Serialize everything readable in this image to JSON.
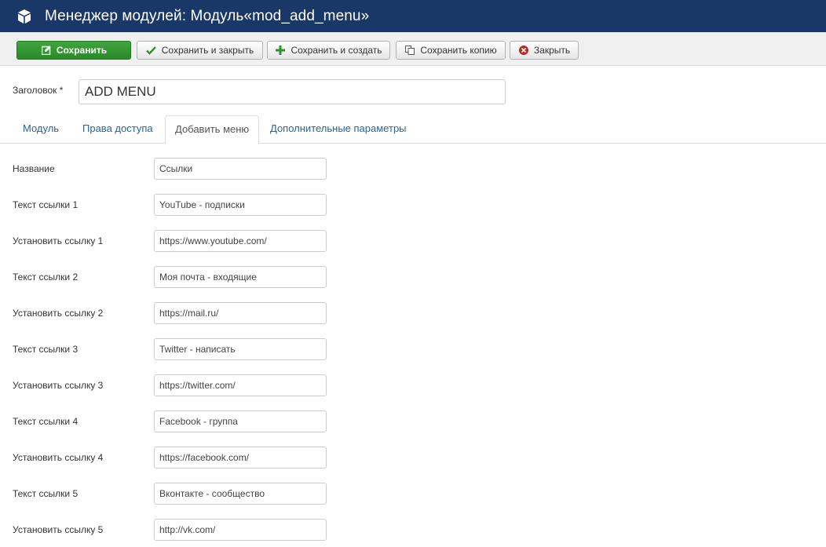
{
  "header": {
    "title": "Менеджер модулей: Модуль«mod_add_menu»",
    "icon": "cube-icon"
  },
  "toolbar": {
    "save": "Сохранить",
    "save_close": "Сохранить и закрыть",
    "save_new": "Сохранить и создать",
    "save_copy": "Сохранить копию",
    "close": "Закрыть"
  },
  "title_field": {
    "label": "Заголовок *",
    "value": "ADD MENU"
  },
  "tabs": [
    {
      "label": "Модуль"
    },
    {
      "label": "Права доступа"
    },
    {
      "label": "Добавить меню",
      "active": true
    },
    {
      "label": "Дополнительные параметры"
    }
  ],
  "fields": [
    {
      "label": "Название",
      "value": "Ссылки"
    },
    {
      "label": "Текст ссылки 1",
      "value": "YouTube - подписки"
    },
    {
      "label": "Установить ссылку 1",
      "value": "https://www.youtube.com/"
    },
    {
      "label": "Текст ссылки 2",
      "value": "Моя почта - входящие"
    },
    {
      "label": "Установить ссылку 2",
      "value": "https://mail.ru/"
    },
    {
      "label": "Текст ссылки 3",
      "value": "Twitter - написать"
    },
    {
      "label": "Установить ссылку 3",
      "value": "https://twitter.com/"
    },
    {
      "label": "Текст ссылки 4",
      "value": "Facebook - группа"
    },
    {
      "label": "Установить ссылку 4",
      "value": "https://facebook.com/"
    },
    {
      "label": "Текст ссылки 5",
      "value": "Вконтакте - сообщество"
    },
    {
      "label": "Установить ссылку 5",
      "value": "http://vk.com/"
    }
  ],
  "colors": {
    "header_bg": "#1a3867",
    "save_green": "#2f922f",
    "link_blue": "#2a6496"
  }
}
